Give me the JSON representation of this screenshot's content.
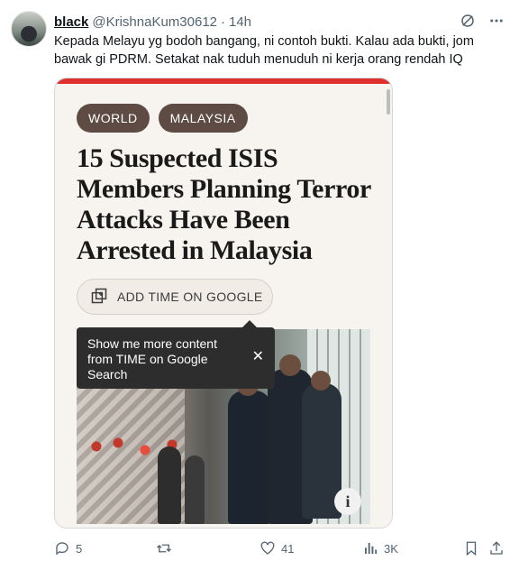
{
  "tweet": {
    "display_name": "black",
    "handle": "@KrishnaKum30612",
    "separator": "·",
    "time": "14h",
    "text": "Kepada Melayu yg bodoh bangang, ni contoh bukti. Kalau ada bukti, jom bawak gi PDRM. Setakat nak tuduh menuduh ni kerja orang rendah IQ"
  },
  "card": {
    "tags": [
      "WORLD",
      "MALAYSIA"
    ],
    "headline": "15 Suspected ISIS Members Planning Terror Attacks Have Been Arrested in Malaysia",
    "add_button_label": "ADD TIME ON GOOGLE",
    "tooltip_text": "Show me more content from TIME on Google Search",
    "tooltip_close": "✕",
    "info_label": "i",
    "accent_color": "#e0302e"
  },
  "actions": {
    "replies": "5",
    "reposts": "",
    "likes": "41",
    "views": "3K"
  },
  "icons": [
    "grok-icon",
    "more-icon",
    "reply-icon",
    "repost-icon",
    "like-icon",
    "views-icon",
    "bookmark-icon",
    "share-icon",
    "add-google-icon",
    "close-icon",
    "info-icon"
  ]
}
